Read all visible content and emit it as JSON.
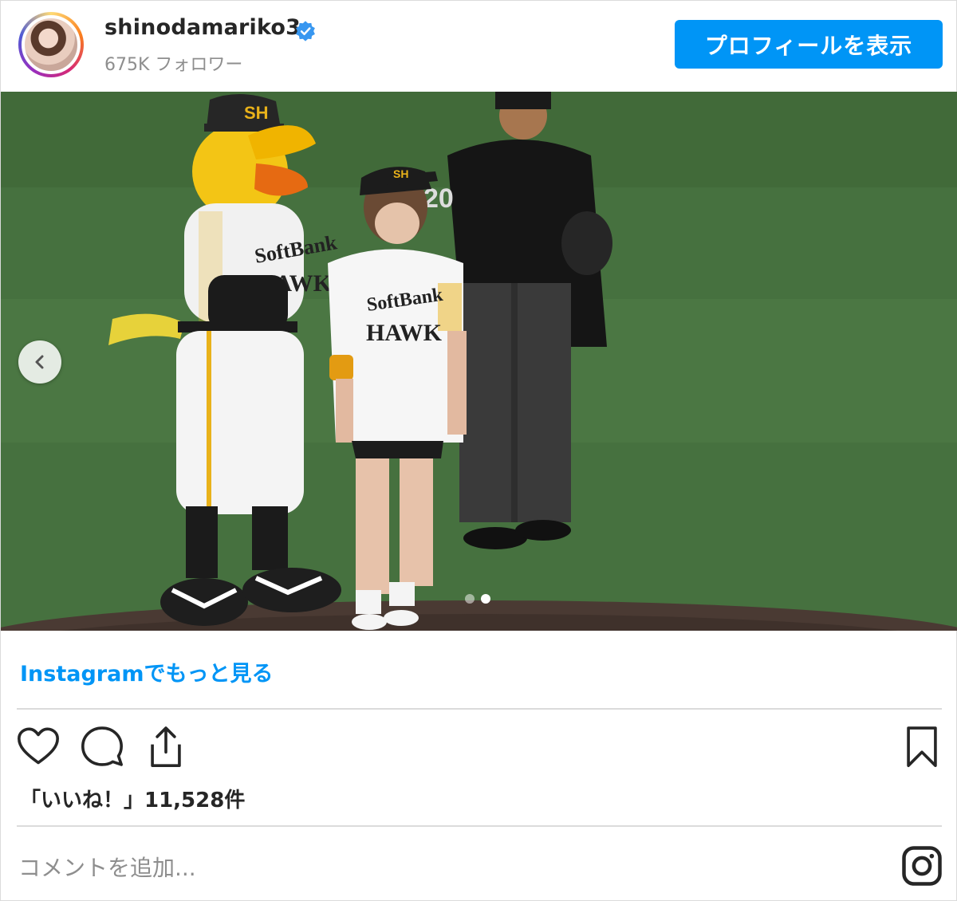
{
  "header": {
    "username": "shinodamariko3",
    "followers": "675K フォロワー",
    "profile_button": "プロフィールを表示"
  },
  "media": {
    "carousel_dots": 2,
    "active_dot": 2
  },
  "see_more": "Instagramでもっと見る",
  "likes": "「いいね！」11,528件",
  "comment_placeholder": "コメントを追加...",
  "colors": {
    "accent": "#0095f6",
    "text": "#262626",
    "muted": "#8e8e8e",
    "border": "#dbdbdb"
  },
  "icons": [
    "verified-badge-icon",
    "chevron-left-icon",
    "heart-icon",
    "comment-icon",
    "share-icon",
    "bookmark-icon",
    "instagram-icon"
  ]
}
